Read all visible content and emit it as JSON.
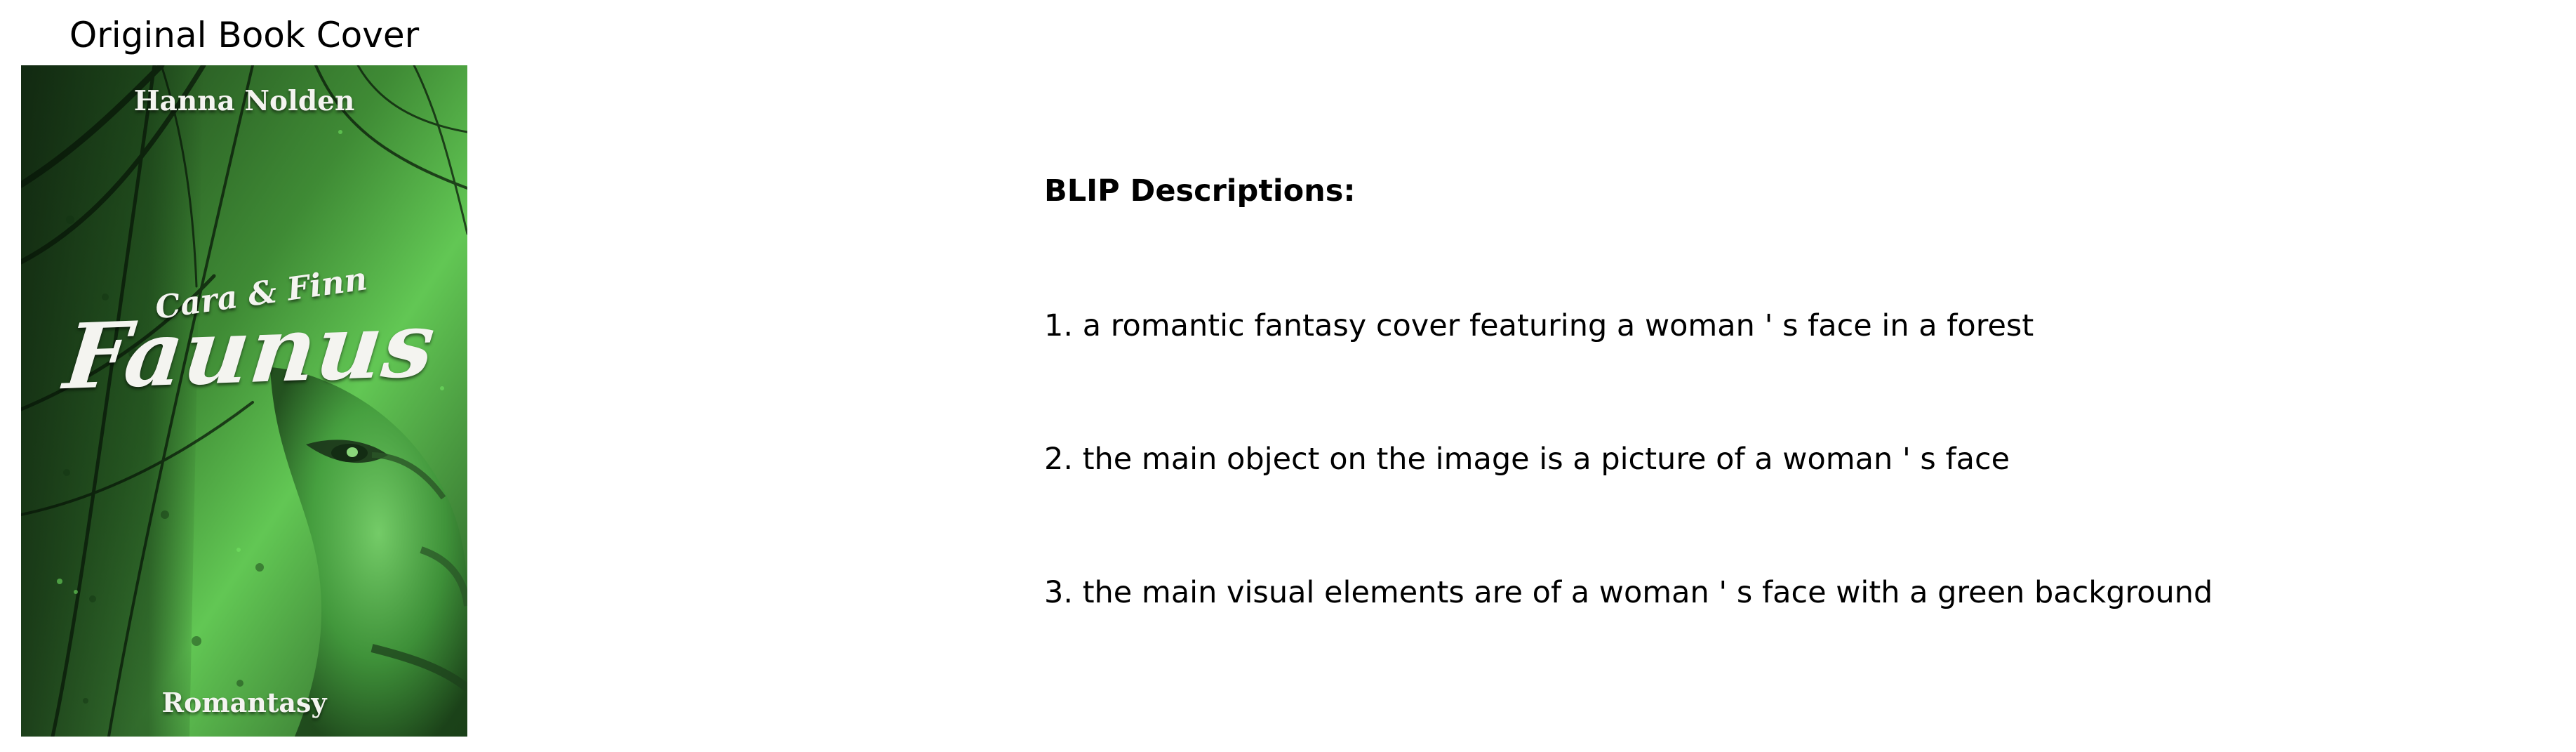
{
  "cover_panel": {
    "title": "Original Book Cover",
    "book": {
      "author": "Hanna Nolden",
      "series": "Cara & Finn",
      "title": "Faunus",
      "genre": "Romantasy"
    },
    "colors": {
      "background_dark": "#173a16",
      "background_green": "#58c04b",
      "text": "#f4f4f0"
    }
  },
  "descriptions": {
    "heading": "BLIP Descriptions:",
    "items": [
      "1. a romantic fantasy cover featuring a woman ' s face in a forest",
      "2. the main object on the image is a picture of a woman ' s face",
      "3. the main visual elements are of a woman ' s face with a green background"
    ]
  }
}
